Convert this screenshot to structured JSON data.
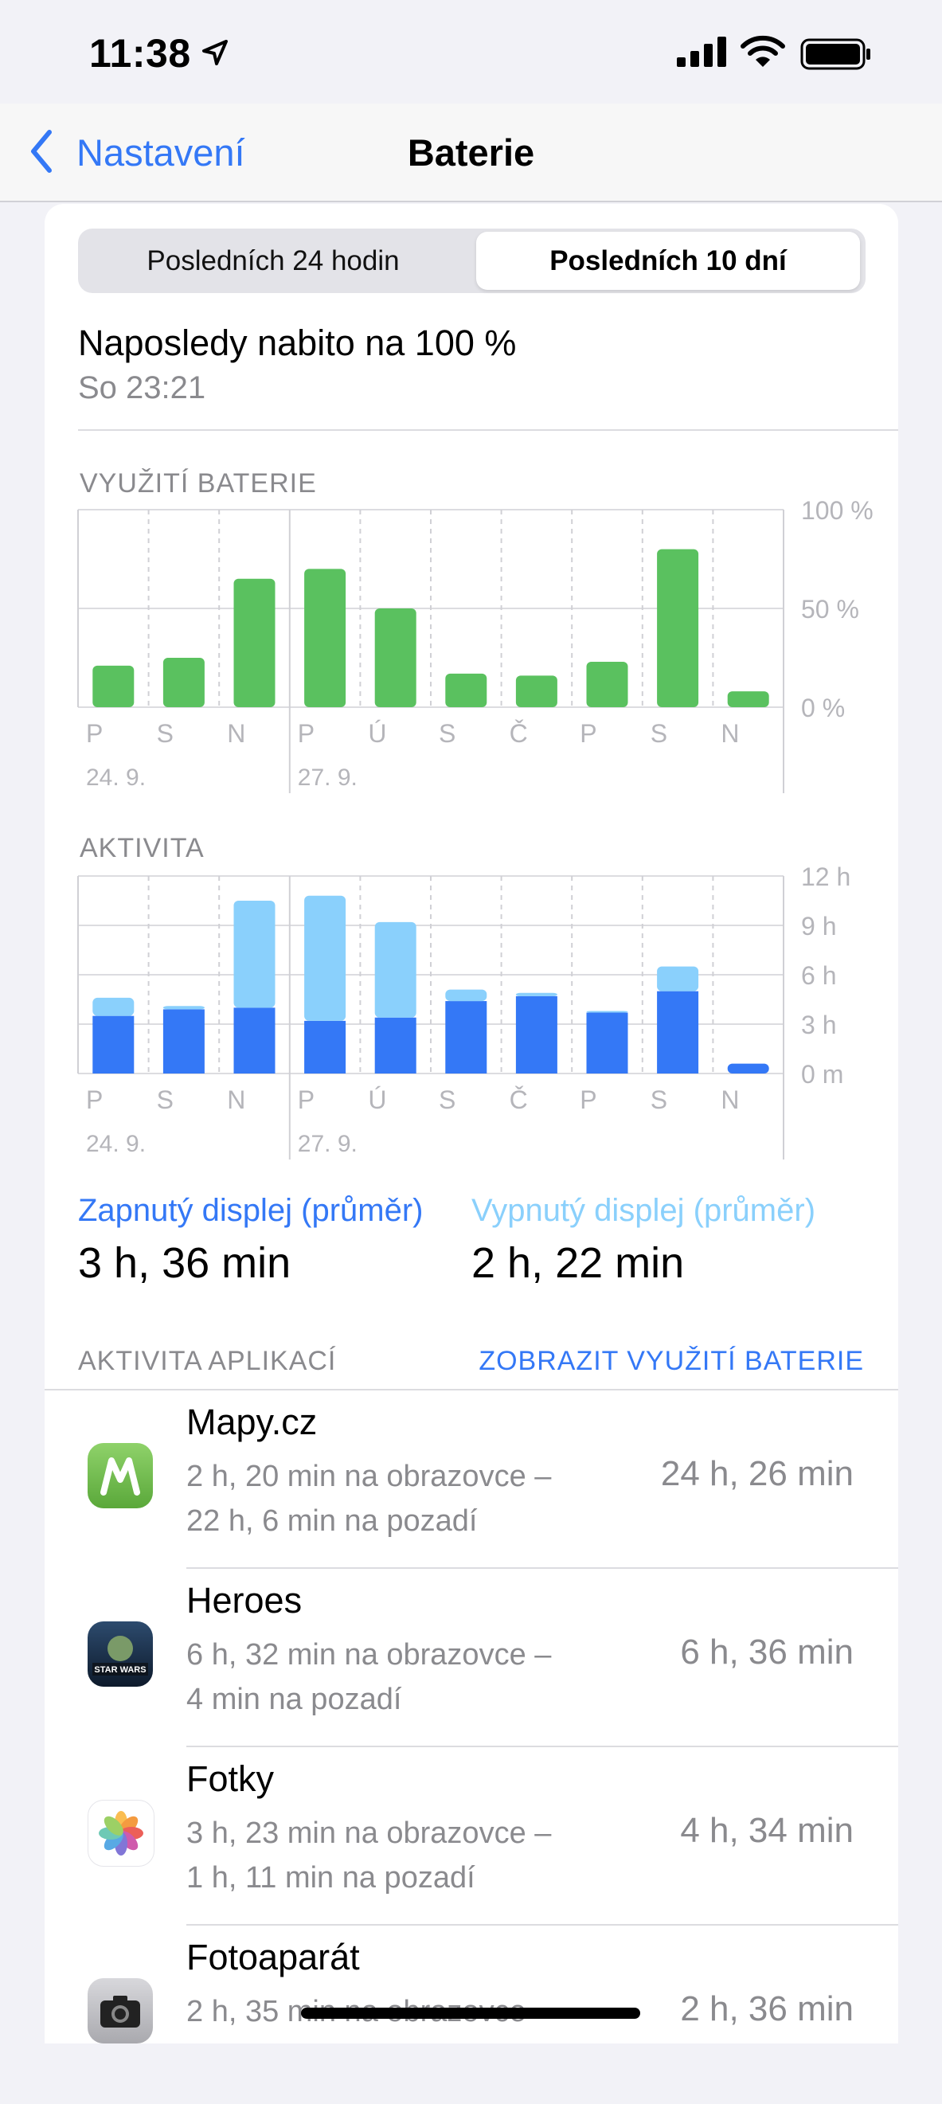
{
  "status_bar": {
    "time": "11:38"
  },
  "nav": {
    "back_label": "Nastavení",
    "title": "Baterie"
  },
  "segments": {
    "left": "Posledních 24 hodin",
    "right": "Posledních 10 dní",
    "selected": "right"
  },
  "last_charged": {
    "title": "Naposledy nabito na 100 %",
    "time": "So 23:21"
  },
  "colors": {
    "accent": "#3478f6",
    "battery_bar": "#5ac15f",
    "screen_on": "#3478f6",
    "screen_off": "#8ad0fc"
  },
  "chart_data": [
    {
      "type": "bar",
      "title": "VYUŽITÍ BATERIE",
      "categories": [
        "P",
        "S",
        "N",
        "P",
        "Ú",
        "S",
        "Č",
        "P",
        "S",
        "N"
      ],
      "date_labels": [
        {
          "index": 0,
          "label": "24. 9."
        },
        {
          "index": 3,
          "label": "27. 9."
        }
      ],
      "values": [
        21,
        25,
        65,
        70,
        50,
        17,
        16,
        23,
        80,
        8
      ],
      "ylim": [
        0,
        100
      ],
      "ytick_labels": [
        "100 %",
        "50 %",
        "0 %"
      ],
      "grid": true
    },
    {
      "type": "bar",
      "stacked": true,
      "title": "AKTIVITA",
      "categories": [
        "P",
        "S",
        "N",
        "P",
        "Ú",
        "S",
        "Č",
        "P",
        "S",
        "N"
      ],
      "date_labels": [
        {
          "index": 0,
          "label": "24. 9."
        },
        {
          "index": 3,
          "label": "27. 9."
        }
      ],
      "series": [
        {
          "values": [
            3.5,
            3.9,
            4.0,
            3.2,
            3.4,
            4.4,
            4.7,
            3.7,
            5.0,
            0.6
          ]
        },
        {
          "values": [
            1.1,
            0.2,
            6.5,
            7.6,
            5.8,
            0.7,
            0.2,
            0.1,
            1.5,
            0
          ]
        }
      ],
      "ylim": [
        0,
        12
      ],
      "ytick_labels": [
        "12 h",
        "9 h",
        "6 h",
        "3 h",
        "0 m"
      ],
      "grid": true
    }
  ],
  "stats": {
    "on_label": "Zapnutý displej (průměr)",
    "on_value": "3 h, 36 min",
    "off_label": "Vypnutý displej (průměr)",
    "off_value": "2 h, 22 min"
  },
  "apps": {
    "section_label": "AKTIVITA APLIKACÍ",
    "link_label": "ZOBRAZIT VYUŽITÍ BATERIE",
    "items": [
      {
        "name": "Mapy.cz",
        "line1": "2 h, 20 min na obrazovce –",
        "line2": "22 h, 6 min na pozadí",
        "total": "24 h, 26 min",
        "icon": "mapy-icon"
      },
      {
        "name": "Heroes",
        "line1": "6 h, 32 min na obrazovce –",
        "line2": "4 min na pozadí",
        "total": "6 h, 36 min",
        "icon": "heroes-icon",
        "icon_text": "STAR WARS"
      },
      {
        "name": "Fotky",
        "line1": "3 h, 23 min na obrazovce –",
        "line2": "1 h, 11 min na pozadí",
        "total": "4 h, 34 min",
        "icon": "photos-icon"
      },
      {
        "name": "Fotoaparát",
        "line1": "2 h, 35 min na obrazovce",
        "line2": "",
        "total": "2 h, 36 min",
        "icon": "camera-icon"
      }
    ]
  }
}
